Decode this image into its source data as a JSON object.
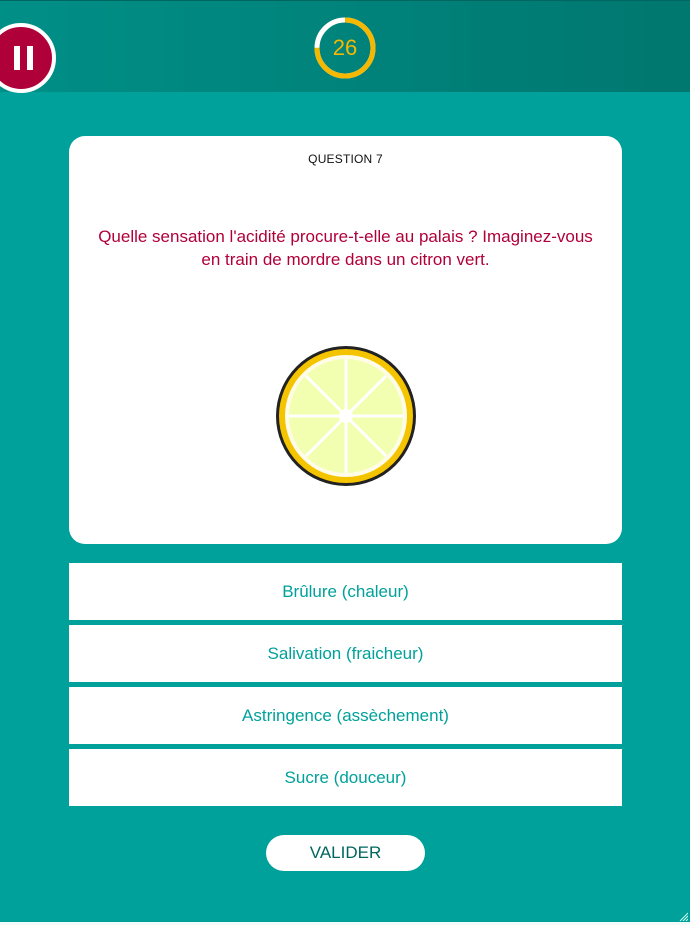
{
  "header": {
    "pause_icon": "pause-icon",
    "timer": {
      "value": "26",
      "progress": 0.75,
      "color": "#f5b800"
    }
  },
  "question": {
    "number_label": "QUESTION 7",
    "text": "Quelle sensation l'acidité procure-t-elle au palais ? Imaginez-vous en train de mordre dans un citron vert.",
    "illustration": "lime-slice-icon"
  },
  "answers": [
    {
      "label": "Brûlure (chaleur)"
    },
    {
      "label": "Salivation (fraicheur)"
    },
    {
      "label": "Astringence (assèchement)"
    },
    {
      "label": "Sucre (douceur)"
    }
  ],
  "actions": {
    "validate_label": "VALIDER"
  },
  "colors": {
    "background": "#00a19a",
    "header": "#00776f",
    "accent": "#b0003a",
    "timer": "#f5b800",
    "answer_text": "#00a19a"
  }
}
